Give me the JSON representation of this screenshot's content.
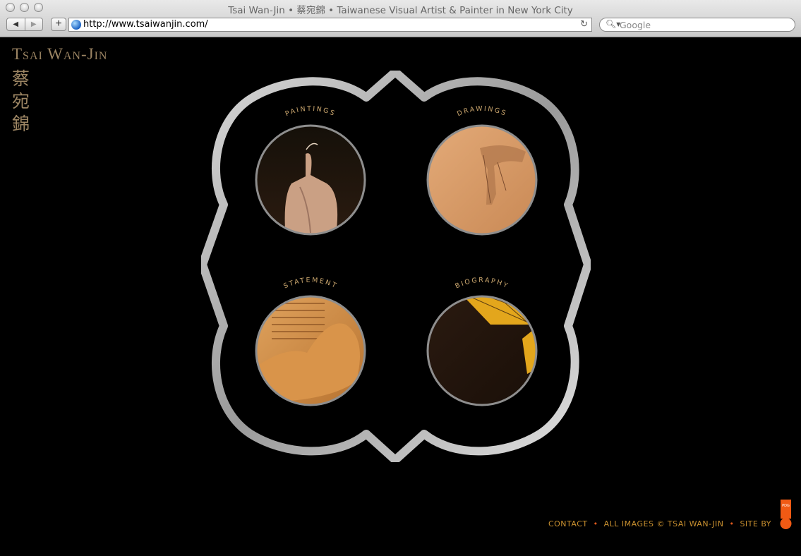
{
  "window": {
    "title": "Tsai Wan-Jin • 蔡宛錦 • Taiwanese Visual Artist & Painter in New York City"
  },
  "toolbar": {
    "back_icon": "back-arrow-icon",
    "forward_icon": "forward-arrow-icon",
    "add_label": "+",
    "url": "http://www.tsaiwanjin.com/",
    "search_placeholder": "Google"
  },
  "site": {
    "name": "Tsai Wan-Jin",
    "name_cjk": "蔡宛錦"
  },
  "sections": {
    "paintings": "PAINTINGS",
    "drawings": "DRAWINGS",
    "statement": "STATEMENT",
    "biography": "BIOGRAPHY"
  },
  "footer": {
    "contact": "CONTACT",
    "copyright": "ALL IMAGES © TSAI WAN-JIN",
    "site_by": "SITE BY",
    "badge": "PDG"
  },
  "colors": {
    "accent_gold": "#9c8563",
    "footer_gold": "#c9902f",
    "footer_dot": "#e05a1c",
    "badge_orange": "#f05a14"
  }
}
